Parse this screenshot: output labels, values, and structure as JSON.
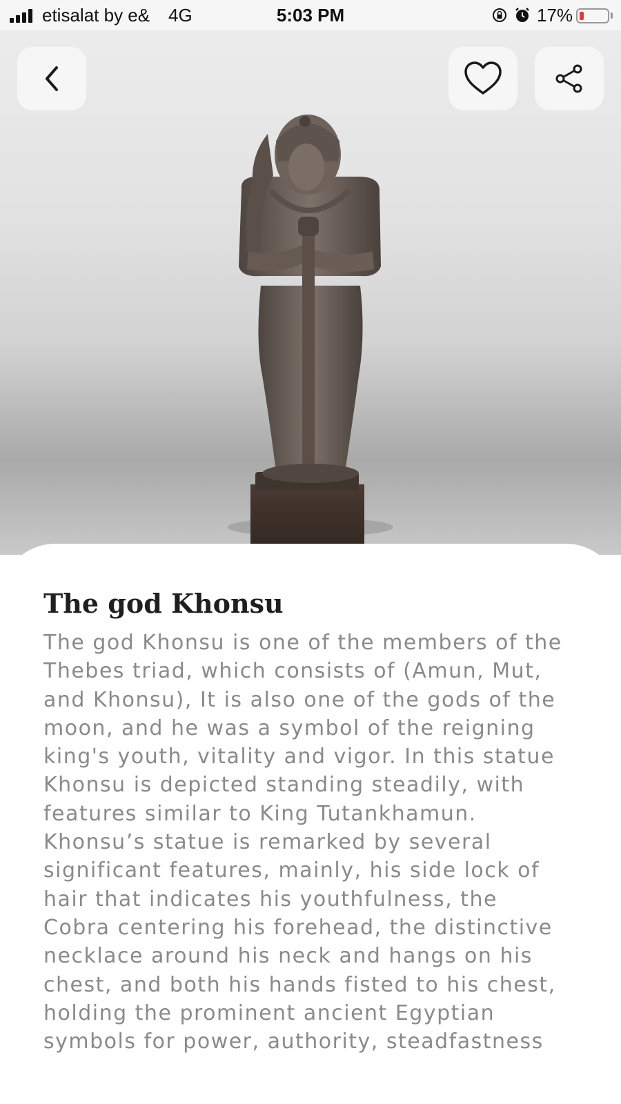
{
  "status_bar": {
    "carrier": "etisalat by e&",
    "network": "4G",
    "time": "5:03 PM",
    "battery_percent": "17%",
    "battery_level": 0.17
  },
  "header": {
    "back_icon": "chevron-left-icon",
    "favorite_icon": "heart-outline-icon",
    "share_icon": "share-icon"
  },
  "artifact": {
    "title": "The god Khonsu",
    "description_lines": [
      "The god Khonsu is one of the members of the",
      "Thebes triad, which consists of (Amun, Mut,",
      "and Khonsu), It is also one of the gods of the",
      "moon, and he was a symbol of the reigning",
      "king's youth, vitality and vigor. In this statue",
      "Khonsu is depicted standing steadily, with",
      "features similar to King Tutankhamun.",
      "Khonsu’s statue is remarked by several",
      "significant features, mainly, his side lock of",
      "hair that indicates his youthfulness, the",
      "Cobra centering his forehead, the distinctive",
      "necklace around his neck and hangs on his",
      "chest, and both his hands fisted to his chest,",
      "holding the prominent ancient Egyptian",
      "symbols for power, authority, steadfastness"
    ]
  }
}
